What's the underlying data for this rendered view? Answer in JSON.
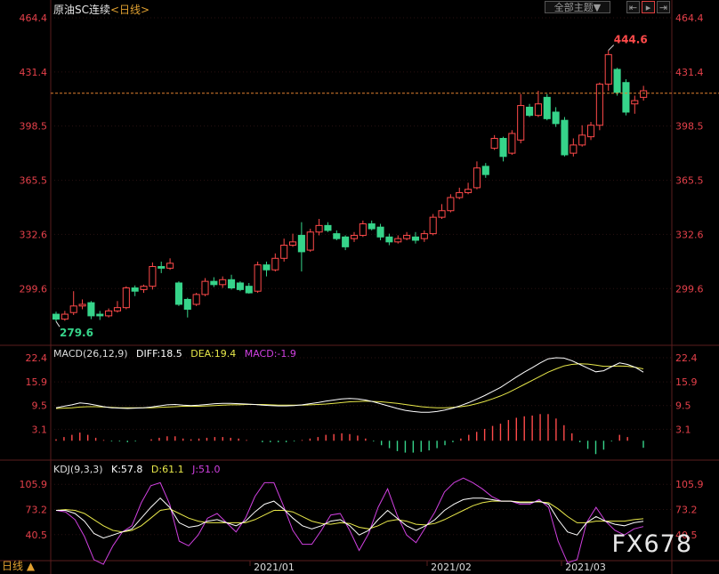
{
  "header": {
    "title": "原油SC连续",
    "period": "<日线>",
    "theme_button": "全部主题▼"
  },
  "period_selector": "日线 ▲",
  "watermark": "FX678",
  "colors": {
    "up": "#ff4a4a",
    "down": "#36d48a",
    "axis_text": "#e5404a",
    "diff": "#ffffff",
    "dea": "#e8e84a",
    "j": "#d040e0",
    "grid": "#3a2020",
    "price_line": "#e08030"
  },
  "chart_data": [
    {
      "type": "candlestick",
      "title": "原油SC连续<日线>",
      "ylim": [
        266.7,
        464.4
      ],
      "y_ticks": [
        "464.4",
        "431.4",
        "398.5",
        "365.5",
        "332.6",
        "299.6"
      ],
      "x_labels": [
        "2021/01",
        "2021/02",
        "2021/03"
      ],
      "high_label": "444.6",
      "low_label": "279.6",
      "current_price_line": 418.5,
      "candles": [
        [
          284.0,
          281.0,
          285.5,
          279.6
        ],
        [
          281.0,
          284.0,
          286.0,
          280.0
        ],
        [
          285.0,
          289.0,
          298.0,
          283.5
        ],
        [
          289.0,
          290.0,
          293.0,
          287.0
        ],
        [
          291.0,
          283.0,
          292.0,
          281.0
        ],
        [
          284.0,
          283.0,
          286.0,
          280.5
        ],
        [
          283.0,
          286.0,
          287.5,
          282.0
        ],
        [
          286.0,
          288.0,
          292.0,
          285.0
        ],
        [
          288.0,
          300.0,
          301.0,
          287.0
        ],
        [
          300.0,
          298.0,
          301.5,
          295.0
        ],
        [
          299.0,
          301.0,
          302.0,
          297.0
        ],
        [
          301.0,
          313.0,
          315.5,
          299.0
        ],
        [
          313.0,
          312.0,
          316.0,
          309.0
        ],
        [
          312.0,
          315.0,
          318.0,
          311.0
        ],
        [
          303.0,
          290.0,
          304.0,
          289.0
        ],
        [
          293.0,
          287.0,
          294.0,
          282.0
        ],
        [
          290.0,
          296.0,
          297.0,
          289.0
        ],
        [
          296.0,
          304.0,
          306.0,
          295.0
        ],
        [
          304.0,
          302.0,
          306.5,
          300.5
        ],
        [
          302.0,
          305.0,
          307.0,
          300.0
        ],
        [
          305.0,
          300.0,
          308.0,
          299.0
        ],
        [
          303.0,
          299.0,
          304.0,
          298.0
        ],
        [
          301.0,
          297.0,
          303.0,
          296.5
        ],
        [
          298.0,
          314.0,
          316.0,
          297.0
        ],
        [
          314.0,
          311.0,
          316.0,
          307.0
        ],
        [
          311.0,
          318.0,
          321.0,
          310.0
        ],
        [
          318.0,
          326.0,
          330.0,
          316.0
        ],
        [
          326.0,
          328.0,
          333.0,
          325.0
        ],
        [
          332.0,
          322.0,
          340.0,
          310.0
        ],
        [
          323.0,
          334.0,
          336.0,
          322.0
        ],
        [
          334.0,
          338.0,
          342.0,
          332.0
        ],
        [
          338.0,
          335.0,
          340.0,
          334.0
        ],
        [
          333.0,
          330.0,
          335.0,
          329.0
        ],
        [
          331.0,
          325.0,
          332.0,
          323.0
        ],
        [
          330.0,
          332.0,
          334.0,
          328.0
        ],
        [
          332.0,
          339.0,
          341.0,
          331.0
        ],
        [
          339.0,
          336.0,
          341.0,
          335.0
        ],
        [
          337.0,
          331.0,
          339.0,
          329.0
        ],
        [
          331.0,
          328.0,
          333.0,
          326.0
        ],
        [
          328.0,
          330.0,
          332.0,
          327.0
        ],
        [
          330.0,
          332.0,
          334.0,
          329.0
        ],
        [
          331.0,
          329.0,
          334.0,
          327.0
        ],
        [
          330.0,
          333.0,
          335.0,
          328.0
        ],
        [
          333.0,
          343.0,
          345.0,
          332.0
        ],
        [
          343.0,
          347.0,
          351.0,
          342.0
        ],
        [
          347.0,
          355.0,
          357.0,
          346.0
        ],
        [
          355.0,
          358.0,
          361.0,
          354.0
        ],
        [
          358.0,
          360.0,
          364.0,
          357.0
        ],
        [
          361.0,
          373.0,
          377.0,
          360.0
        ],
        [
          374.0,
          369.0,
          376.0,
          367.0
        ],
        [
          385.0,
          391.0,
          393.0,
          384.0
        ],
        [
          391.0,
          380.0,
          392.0,
          377.0
        ],
        [
          382.0,
          394.0,
          396.0,
          381.0
        ],
        [
          390.0,
          411.0,
          418.0,
          388.0
        ],
        [
          410.0,
          405.0,
          412.0,
          404.0
        ],
        [
          405.0,
          412.0,
          420.0,
          404.0
        ],
        [
          416.0,
          403.0,
          418.0,
          402.0
        ],
        [
          407.0,
          400.0,
          410.0,
          398.0
        ],
        [
          402.0,
          381.0,
          404.0,
          380.0
        ],
        [
          382.0,
          387.0,
          391.0,
          380.0
        ],
        [
          387.0,
          393.0,
          399.0,
          386.0
        ],
        [
          392.0,
          399.0,
          401.0,
          390.0
        ],
        [
          399.0,
          424.0,
          425.0,
          396.0
        ],
        [
          424.0,
          442.0,
          444.6,
          420.0
        ],
        [
          433.0,
          419.0,
          434.0,
          417.0
        ],
        [
          425.0,
          407.0,
          427.0,
          405.0
        ],
        [
          412.0,
          414.0,
          417.0,
          406.0
        ],
        [
          416.0,
          420.0,
          423.0,
          414.0
        ]
      ]
    },
    {
      "type": "macd",
      "label_name": "MACD(26,12,9)",
      "diff_label": "DIFF:18.5",
      "dea_label": "DEA:19.4",
      "macd_label": "MACD:-1.9",
      "ylim": [
        -4.5,
        22.4
      ],
      "y_ticks": [
        "22.4",
        "15.9",
        "9.5",
        "3.1"
      ],
      "diff": [
        8.9,
        9.3,
        9.7,
        10.2,
        10.0,
        9.6,
        9.2,
        8.9,
        8.8,
        8.7,
        8.8,
        8.9,
        9.1,
        9.4,
        9.7,
        9.8,
        9.6,
        9.5,
        9.6,
        9.8,
        10.0,
        10.1,
        10.1,
        10.0,
        9.9,
        9.8,
        9.6,
        9.5,
        9.4,
        9.4,
        9.5,
        9.7,
        10.0,
        10.3,
        10.7,
        11.0,
        11.3,
        11.4,
        11.3,
        11.0,
        10.5,
        9.9,
        9.3,
        8.7,
        8.2,
        7.9,
        7.7,
        7.7,
        7.9,
        8.3,
        8.8,
        9.5,
        10.3,
        11.2,
        12.2,
        13.3,
        14.4,
        15.8,
        17.2,
        18.5,
        19.7,
        21.0,
        22.1,
        22.4,
        22.3,
        21.6,
        20.6,
        19.6,
        18.6,
        18.9,
        20.0,
        21.0,
        20.6,
        19.8,
        18.5
      ],
      "dea": [
        8.7,
        8.8,
        8.9,
        9.1,
        9.2,
        9.2,
        9.1,
        9.0,
        8.9,
        8.9,
        8.9,
        8.9,
        8.9,
        9.0,
        9.1,
        9.2,
        9.3,
        9.3,
        9.3,
        9.4,
        9.5,
        9.6,
        9.7,
        9.7,
        9.8,
        9.8,
        9.8,
        9.7,
        9.6,
        9.6,
        9.6,
        9.6,
        9.7,
        9.8,
        9.9,
        10.1,
        10.3,
        10.5,
        10.6,
        10.7,
        10.6,
        10.5,
        10.3,
        10.1,
        9.8,
        9.5,
        9.2,
        9.0,
        8.9,
        8.9,
        9.0,
        9.2,
        9.5,
        10.0,
        10.6,
        11.3,
        12.1,
        13.0,
        14.1,
        15.2,
        16.3,
        17.4,
        18.5,
        19.4,
        20.2,
        20.6,
        20.8,
        20.7,
        20.4,
        20.1,
        20.1,
        20.2,
        20.1,
        19.8,
        19.4
      ],
      "macd": [
        0.4,
        1.0,
        1.6,
        2.2,
        1.6,
        0.8,
        0.2,
        -0.2,
        -0.2,
        -0.4,
        -0.2,
        0.0,
        0.4,
        0.8,
        1.2,
        1.2,
        0.6,
        0.4,
        0.6,
        0.8,
        1.0,
        1.0,
        0.8,
        0.6,
        0.2,
        0.0,
        -0.4,
        -0.4,
        -0.4,
        -0.4,
        -0.2,
        0.2,
        0.6,
        1.0,
        1.6,
        1.8,
        2.0,
        1.8,
        1.4,
        0.6,
        -0.2,
        -1.2,
        -2.0,
        -2.8,
        -3.2,
        -3.2,
        -3.0,
        -2.6,
        -2.0,
        -1.2,
        -0.4,
        0.6,
        1.6,
        2.4,
        3.2,
        4.0,
        4.6,
        5.6,
        6.2,
        6.6,
        6.8,
        7.2,
        7.2,
        6.0,
        4.2,
        2.0,
        -0.4,
        -2.2,
        -3.6,
        -2.4,
        -0.2,
        1.6,
        1.0,
        0.0,
        -1.9
      ]
    },
    {
      "type": "kdj",
      "label_name": "KDJ(9,3,3)",
      "k_label": "K:57.8",
      "d_label": "D:61.1",
      "j_label": "J:51.0",
      "ylim": [
        9.0,
        120.0
      ],
      "y_ticks": [
        "105.9",
        "73.2",
        "40.5"
      ],
      "k": [
        72.0,
        72.0,
        68.0,
        58.0,
        42.0,
        36.0,
        40.0,
        44.0,
        48.0,
        62.0,
        76.0,
        88.0,
        76.0,
        56.0,
        50.0,
        52.0,
        58.0,
        60.0,
        56.0,
        52.0,
        58.0,
        70.0,
        80.0,
        84.0,
        74.0,
        62.0,
        52.0,
        48.0,
        52.0,
        58.0,
        60.0,
        52.0,
        40.0,
        46.0,
        60.0,
        72.0,
        62.0,
        52.0,
        46.0,
        52.0,
        60.0,
        72.0,
        80.0,
        86.0,
        88.0,
        88.0,
        86.0,
        84.0,
        84.0,
        82.0,
        82.0,
        84.0,
        80.0,
        60.0,
        44.0,
        40.0,
        56.0,
        64.0,
        58.0,
        54.0,
        52.0,
        56.0,
        57.8
      ],
      "d": [
        72.0,
        73.0,
        72.0,
        68.0,
        60.0,
        52.0,
        46.0,
        44.0,
        46.0,
        52.0,
        62.0,
        72.0,
        74.0,
        68.0,
        62.0,
        58.0,
        56.0,
        56.0,
        56.0,
        56.0,
        56.0,
        60.0,
        66.0,
        72.0,
        72.0,
        70.0,
        64.0,
        58.0,
        55.0,
        54.0,
        56.0,
        55.0,
        50.0,
        48.0,
        52.0,
        58.0,
        60.0,
        58.0,
        54.0,
        53.0,
        55.0,
        60.0,
        66.0,
        72.0,
        78.0,
        82.0,
        84.0,
        84.0,
        84.0,
        83.0,
        83.0,
        83.0,
        82.0,
        74.0,
        64.0,
        56.0,
        56.0,
        58.0,
        58.0,
        58.0,
        58.0,
        60.0,
        61.1
      ],
      "j": [
        72.0,
        70.0,
        60.0,
        38.0,
        8.0,
        2.0,
        26.0,
        44.0,
        52.0,
        82.0,
        104.0,
        108.0,
        80.0,
        32.0,
        26.0,
        40.0,
        62.0,
        68.0,
        56.0,
        44.0,
        62.0,
        90.0,
        108.0,
        108.0,
        78.0,
        46.0,
        28.0,
        28.0,
        46.0,
        66.0,
        68.0,
        46.0,
        20.0,
        42.0,
        76.0,
        100.0,
        66.0,
        40.0,
        30.0,
        50.0,
        70.0,
        96.0,
        108.0,
        114.0,
        108.0,
        100.0,
        90.0,
        84.0,
        84.0,
        80.0,
        80.0,
        86.0,
        76.0,
        32.0,
        4.0,
        8.0,
        56.0,
        76.0,
        58.0,
        46.0,
        40.0,
        48.0,
        51.0
      ]
    }
  ]
}
